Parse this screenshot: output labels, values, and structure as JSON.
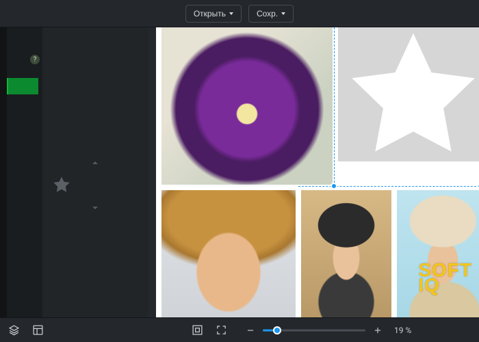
{
  "toolbar": {
    "open_label": "Открыть",
    "save_label": "Сохр."
  },
  "sidebar": {
    "help_glyph": "?"
  },
  "canvas": {
    "cells": [
      {
        "name": "flower-photo"
      },
      {
        "name": "star-placeholder"
      },
      {
        "name": "woman-smiling-photo"
      },
      {
        "name": "woman-black-hat-photo"
      },
      {
        "name": "woman-straw-hat-photo"
      }
    ]
  },
  "bottom": {
    "zoom_percent": 19,
    "zoom_label": "19 %",
    "slider_percent": 14
  },
  "watermark": {
    "line1": "SOFT",
    "line2": "IQ"
  },
  "icons": {
    "layers": "layers",
    "layout": "layout",
    "fit": "fit",
    "fullscreen": "fullscreen",
    "minus": "−",
    "plus": "+"
  }
}
